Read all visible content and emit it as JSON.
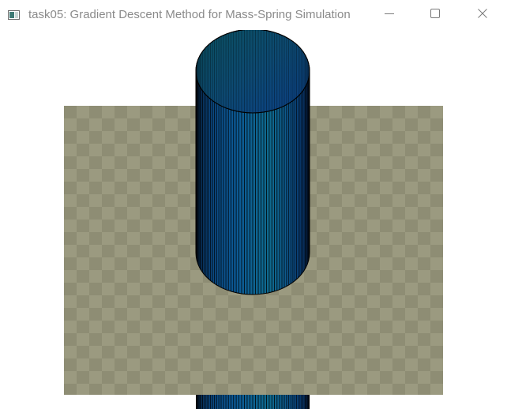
{
  "window": {
    "title": "task05: Gradient Descent Method for Mass-Spring Simulation"
  },
  "controls": {
    "minimize_icon": "minimize-icon",
    "maximize_icon": "maximize-icon",
    "close_icon": "close-icon"
  },
  "scene": {
    "background_color": "#ffffff",
    "floor_color_light": "#9b9a80",
    "floor_color_dark": "#8e8d74",
    "cylinder_color_dark": "#0b4a86",
    "cylinder_color_light": "#0e6a99",
    "cylinder_top_color": "#0d4f6b",
    "edge_color": "#000000"
  }
}
